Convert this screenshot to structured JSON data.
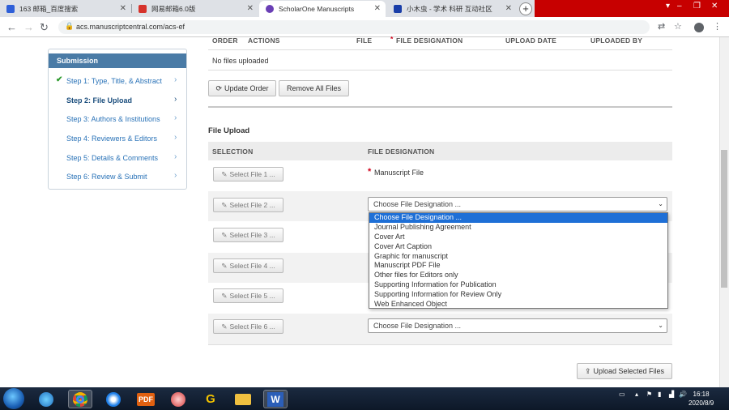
{
  "browser": {
    "tabs": [
      {
        "title": "163 邮箱_百度搜索",
        "icon": "baidu-paw-icon",
        "color": "#2e5fd8"
      },
      {
        "title": "网易邮箱6.0版",
        "icon": "netease-mail-icon",
        "color": "#d6322b"
      },
      {
        "title": "ScholarOne Manuscripts",
        "icon": "scholarone-icon",
        "color": "#6a3fb5"
      },
      {
        "title": "小木虫 - 学术 科研 互动社区",
        "icon": "xiaomuchong-icon",
        "color": "#1a3ea8"
      }
    ],
    "url": "acs.manuscriptcentral.com/acs-ef"
  },
  "sidebar": {
    "title": "Submission",
    "steps": [
      {
        "label": "Step 1: Type, Title, & Abstract",
        "done": true
      },
      {
        "label": "Step 2: File Upload",
        "current": true
      },
      {
        "label": "Step 3: Authors & Institutions"
      },
      {
        "label": "Step 4: Reviewers & Editors"
      },
      {
        "label": "Step 5: Details & Comments"
      },
      {
        "label": "Step 6: Review & Submit"
      }
    ]
  },
  "files_table": {
    "headers": {
      "order": "ORDER",
      "actions": "ACTIONS",
      "file": "FILE",
      "required_mark": "*",
      "designation": "FILE DESIGNATION",
      "upload_date": "UPLOAD DATE",
      "uploaded_by": "UPLOADED BY"
    },
    "empty_text": "No files uploaded",
    "update_order": "Update Order",
    "remove_all": "Remove All Files"
  },
  "file_upload": {
    "title": "File Upload",
    "headers": {
      "selection": "SELECTION",
      "designation": "FILE DESIGNATION"
    },
    "select_labels": [
      "Select File 1 ...",
      "Select File 2 ...",
      "Select File 3 ...",
      "Select File 4 ...",
      "Select File 5 ...",
      "Select File 6 ..."
    ],
    "manuscript_file": {
      "mark": "*",
      "label": "Manuscript File"
    },
    "select_placeholder": "Choose File Designation ...",
    "dropdown_options": [
      "Choose File Designation ...",
      "Journal Publishing Agreement",
      "Cover Art",
      "Cover Art Caption",
      "Graphic for manuscript",
      "Manuscript PDF File",
      "Other files for Editors only",
      "Supporting Information for Publication",
      "Supporting Information for Review Only",
      "Web Enhanced Object"
    ],
    "upload_button": "Upload Selected Files"
  },
  "taskbar": {
    "apps": [
      "ie-icon",
      "media-icon",
      "chrome-icon",
      "browser-icon",
      "pdf-icon",
      "paint-icon",
      "g-icon",
      "explorer-icon",
      "word-icon"
    ],
    "pdf_label": "PDF",
    "word_label": "W",
    "g_label": "G",
    "time": "16:18",
    "date": "2020/8/9"
  },
  "colors": {
    "accent": "#4a7ba6",
    "link": "#2a73b8",
    "highlight": "#1e6fd6",
    "required": "#d0021b"
  }
}
